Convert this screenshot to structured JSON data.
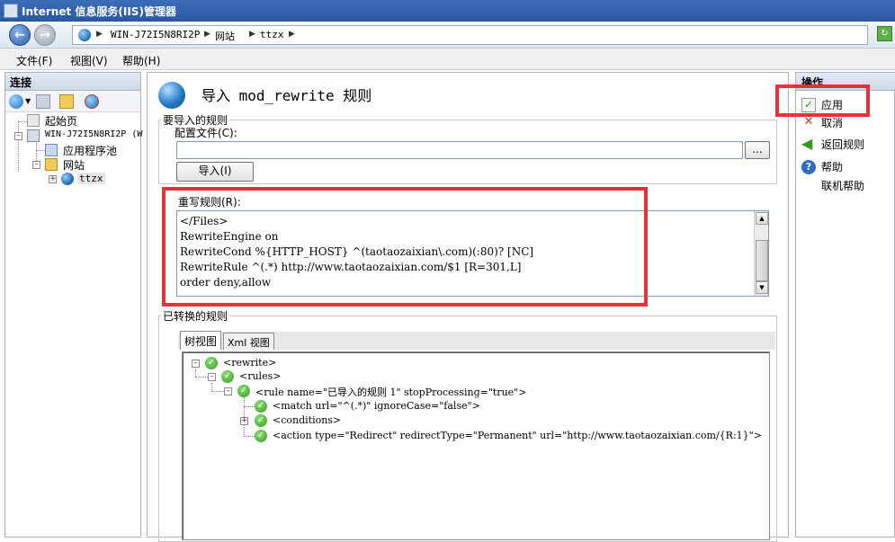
{
  "window": {
    "title": "Internet 信息服务(IIS)管理器"
  },
  "address": {
    "crumbs": [
      "WIN-J72I5N8RI2P",
      "网站",
      "ttzx"
    ]
  },
  "menu": {
    "items": [
      "文件(F)",
      "视图(V)",
      "帮助(H)"
    ]
  },
  "connections": {
    "title": "连接",
    "tree": {
      "start_page": "起始页",
      "server": "WIN-J72I5N8RI2P (W",
      "app_pools": "应用程序池",
      "sites": "网站",
      "site": "ttzx"
    }
  },
  "main": {
    "title": "导入 mod_rewrite 规则",
    "import_group": {
      "legend": "要导入的规则",
      "config_label": "配置文件(C):",
      "config_value": "",
      "browse_label": "...",
      "import_button": "导入(I)"
    },
    "rules": {
      "label": "重写规则(R):",
      "lines": [
        "</Files>",
        "RewriteEngine on",
        "RewriteCond %{HTTP_HOST} ^(taotaozaixian\\.com)(:80)? [NC]",
        "RewriteRule ^(.*) http://www.taotaozaixian.com/$1 [R=301,L]",
        "order deny,allow"
      ]
    },
    "converted": {
      "legend": "已转换的规则",
      "tabs": [
        "树视图",
        "Xml 视图"
      ],
      "tree_lines": [
        "<rewrite>",
        "<rules>",
        "<rule name=\"已导入的规则 1\" stopProcessing=\"true\">",
        "<match url=\"^(.*)\" ignoreCase=\"false\">",
        "<conditions>",
        "<action type=\"Redirect\" redirectType=\"Permanent\" url=\"http://www.taotaozaixian.com/{R:1}\">"
      ]
    }
  },
  "actions": {
    "title": "操作",
    "items": [
      "应用",
      "取消",
      "返回规则",
      "帮助",
      "联机帮助"
    ]
  },
  "colors": {
    "highlight": "#e4313a",
    "accent": "#2a579f"
  }
}
